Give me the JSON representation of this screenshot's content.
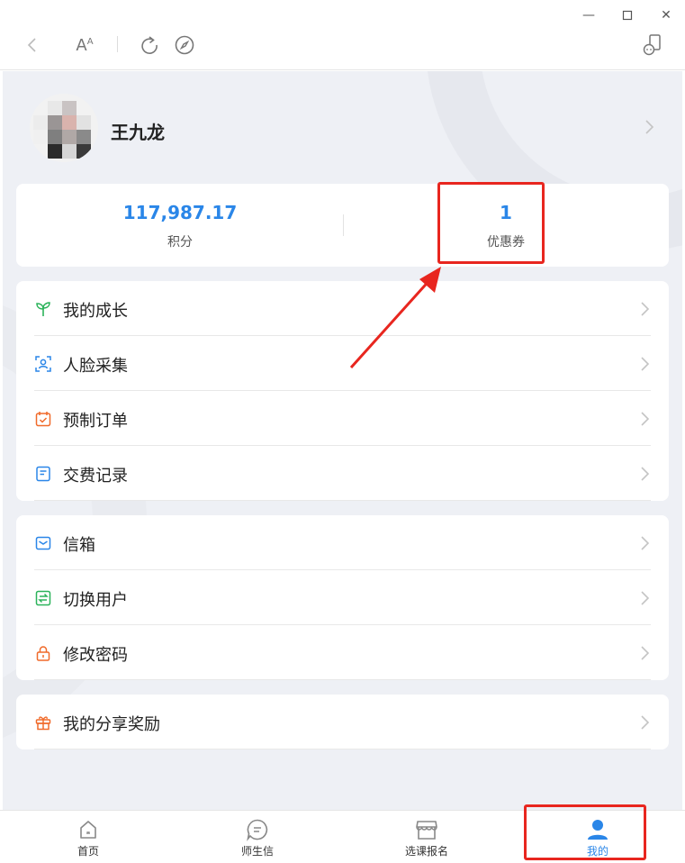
{
  "window": {
    "minimize_glyph": "—",
    "maximize_glyph": "☐",
    "close_glyph": "✕"
  },
  "toolbar": {
    "font_size_label": "AA"
  },
  "profile": {
    "username": "王九龙"
  },
  "stats": {
    "points_value": "117,987.17",
    "points_label": "积分",
    "coupons_value": "1",
    "coupons_label": "优惠券"
  },
  "menu_groups": [
    {
      "items": [
        {
          "label": "我的成长",
          "icon": "sprout-icon",
          "color": "#2bb35a"
        },
        {
          "label": "人脸采集",
          "icon": "face-scan-icon",
          "color": "#2a86e8"
        },
        {
          "label": "预制订单",
          "icon": "calendar-check-icon",
          "color": "#f06a2a"
        },
        {
          "label": "交费记录",
          "icon": "document-icon",
          "color": "#2a86e8"
        }
      ]
    },
    {
      "items": [
        {
          "label": "信箱",
          "icon": "mailbox-icon",
          "color": "#2a86e8"
        },
        {
          "label": "切换用户",
          "icon": "switch-icon",
          "color": "#2bb35a"
        },
        {
          "label": "修改密码",
          "icon": "lock-icon",
          "color": "#f06a2a"
        }
      ]
    },
    {
      "items": [
        {
          "label": "我的分享奖励",
          "icon": "gift-icon",
          "color": "#f06a2a"
        }
      ]
    }
  ],
  "tabs": [
    {
      "label": "首页",
      "icon": "home-icon"
    },
    {
      "label": "师生信",
      "icon": "message-icon"
    },
    {
      "label": "选课报名",
      "icon": "store-icon"
    },
    {
      "label": "我的",
      "icon": "user-icon",
      "active": true
    }
  ],
  "colors": {
    "accent": "#2a86e8",
    "highlight": "#e8261f",
    "page_bg": "#eef0f5"
  }
}
